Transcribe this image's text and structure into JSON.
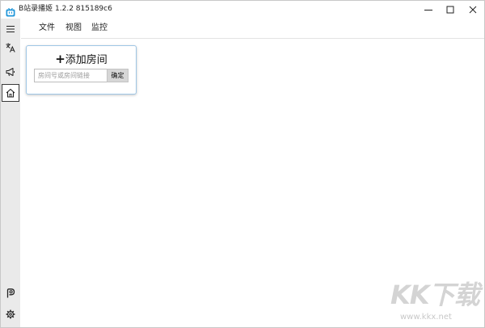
{
  "window": {
    "title": "B站录播姬 1.2.2 815189c6",
    "icon": "bilibili-tv-icon",
    "controls": [
      "minimize-icon",
      "maximize-icon",
      "close-icon"
    ]
  },
  "sidebar": {
    "items": [
      {
        "name": "hamburger-menu",
        "icon": "hamburger-icon"
      },
      {
        "name": "language",
        "icon": "translate-icon"
      },
      {
        "name": "announcement",
        "icon": "megaphone-icon"
      },
      {
        "name": "home",
        "icon": "home-icon",
        "selected": true
      },
      {
        "name": "project",
        "icon": "p-logo-icon"
      },
      {
        "name": "settings",
        "icon": "gear-icon"
      }
    ]
  },
  "menu": {
    "file": "文件",
    "view": "视图",
    "monitor": "监控"
  },
  "add_room": {
    "title": "添加房间",
    "plus_symbol": "+",
    "input_value": "",
    "input_placeholder": "房间号或房间链接",
    "confirm_label": "确定"
  },
  "watermark": {
    "logo_text": "KK下载",
    "url": "www.kkx.net"
  },
  "colors": {
    "sidebar_bg": "#eaeaea",
    "card_border": "#9fc6e5",
    "confirm_bg": "#d6d6d6",
    "app_icon": "#2196d9"
  }
}
